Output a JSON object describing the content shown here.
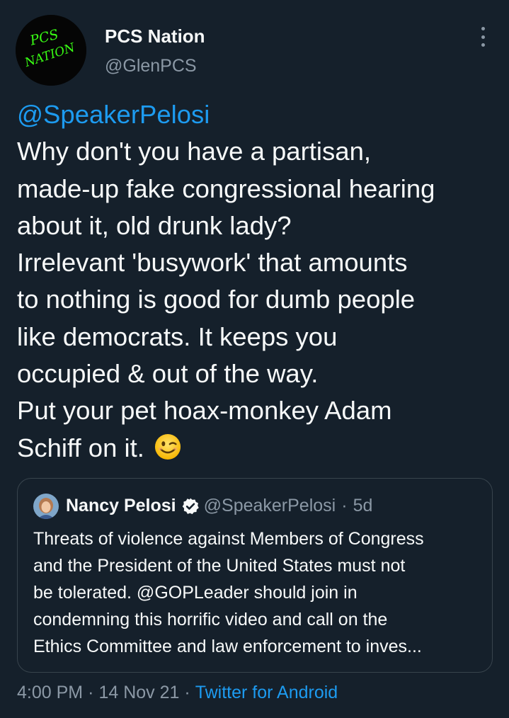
{
  "author": {
    "name": "PCS Nation",
    "handle": "@GlenPCS",
    "avatar_text": [
      "PCS",
      "NATION"
    ],
    "avatar_colors": {
      "background": "#050505",
      "letters": "#39ff14"
    }
  },
  "tweet": {
    "mention": "@SpeakerPelosi",
    "lines": [
      "Why don't you have a partisan,",
      "made-up fake congressional hearing",
      "about it, old drunk lady?",
      "Irrelevant 'busywork' that amounts",
      "to nothing is good for dumb people",
      "like democrats. It keeps you",
      "occupied & out of the way.",
      "Put your pet hoax-monkey Adam",
      "Schiff on it."
    ],
    "emoji": "winking-face"
  },
  "quote": {
    "name": "Nancy Pelosi",
    "handle": "@SpeakerPelosi",
    "separator": "·",
    "age": "5d",
    "lines": [
      "Threats of violence against Members of Congress",
      "and the President of the United States must not",
      "be tolerated. @GOPLeader should join in",
      "condemning this horrific video and call on the",
      "Ethics Committee and law enforcement to inves..."
    ]
  },
  "meta": {
    "time": "4:00 PM",
    "separator": "·",
    "date": "14 Nov 21",
    "source": "Twitter for Android"
  },
  "colors": {
    "background": "#15202b",
    "text": "#f7f9f9",
    "secondary": "#8b98a5",
    "accent": "#1d9bf0",
    "border": "#38444d"
  }
}
